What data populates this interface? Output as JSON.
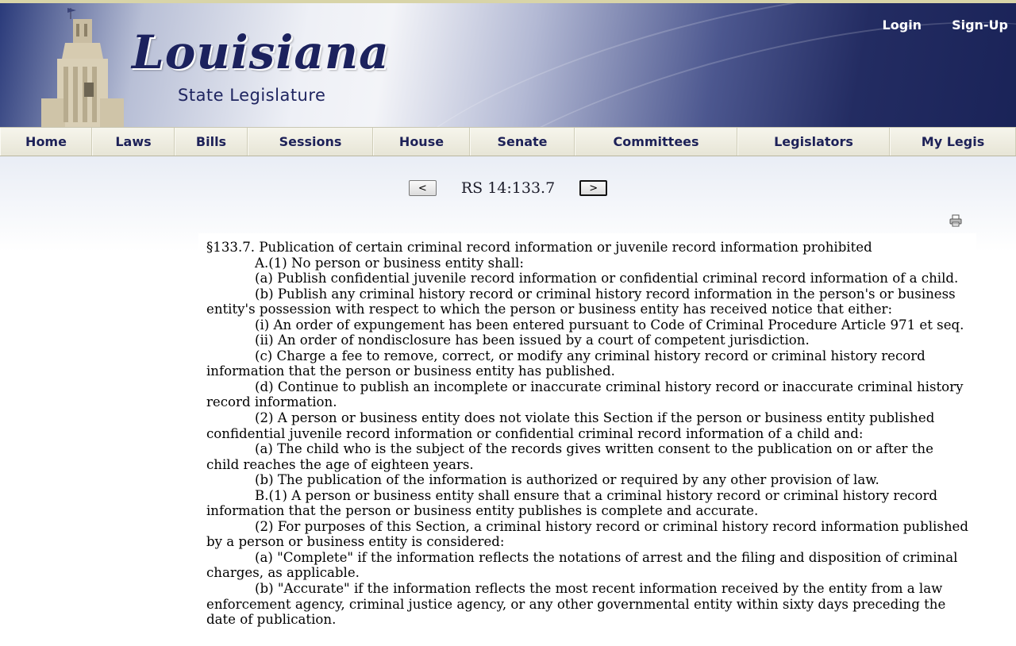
{
  "site": {
    "logo_title": "Louisiana",
    "logo_subtitle": "State Legislature",
    "auth": {
      "login": "Login",
      "signup": "Sign-Up"
    },
    "nav": [
      "Home",
      "Laws",
      "Bills",
      "Sessions",
      "House",
      "Senate",
      "Committees",
      "Legislators",
      "My Legis"
    ]
  },
  "pager": {
    "prev_label": "<",
    "next_label": ">",
    "title": "RS 14:133.7"
  },
  "icons": {
    "print": "printer-icon"
  },
  "law": {
    "heading": "§133.7. Publication of certain criminal record information or juvenile record information prohibited",
    "paragraphs": [
      "A.(1) No person or business entity shall:",
      "(a) Publish confidential juvenile record information or confidential criminal record information of a child.",
      "(b) Publish any criminal history record or criminal history record information in the person's or business entity's possession with respect to which the person or business entity has received notice that either:",
      "(i) An order of expungement has been entered pursuant to Code of Criminal Procedure Article 971 et seq.",
      "(ii) An order of nondisclosure has been issued by a court of competent jurisdiction.",
      "(c) Charge a fee to remove, correct, or modify any criminal history record or criminal history record information that the person or business entity has published.",
      "(d) Continue to publish an incomplete or inaccurate criminal history record or inaccurate criminal history record information.",
      "(2) A person or business entity does not violate this Section if the person or business entity published confidential juvenile record information or confidential criminal record information of a child and:",
      "(a) The child who is the subject of the records gives written consent to the publication on or after the child reaches the age of eighteen years.",
      "(b) The publication of the information is authorized or required by any other provision of law.",
      "B.(1) A person or business entity shall ensure that a criminal history record or criminal history record information that the person or business entity publishes is complete and accurate.",
      "(2) For purposes of this Section, a criminal history record or criminal history record information published by a person or business entity is considered:",
      "(a) \"Complete\" if the information reflects the notations of arrest and the filing and disposition of criminal charges, as applicable.",
      "(b) \"Accurate\" if the information reflects the most recent information received by the entity from a law enforcement agency, criminal justice agency, or any other governmental entity within sixty days preceding the date of publication."
    ]
  }
}
